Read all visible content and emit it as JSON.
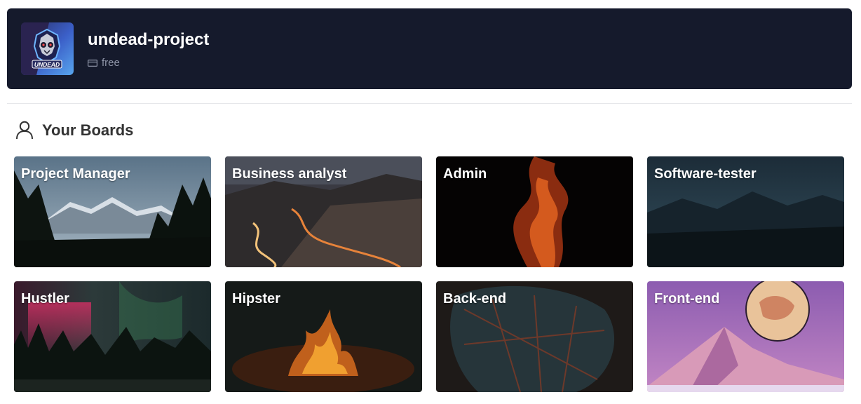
{
  "workspace": {
    "name": "undead-project",
    "plan": "free",
    "logo_text": "UNDEAD"
  },
  "section": {
    "title": "Your Boards"
  },
  "boards": [
    {
      "title": "Project Manager",
      "theme": "pine-forest-mountains"
    },
    {
      "title": "Business analyst",
      "theme": "winding-road-night"
    },
    {
      "title": "Admin",
      "theme": "flame-on-black"
    },
    {
      "title": "Software-tester",
      "theme": "dark-blue-mountains"
    },
    {
      "title": "Hustler",
      "theme": "aurora-forest"
    },
    {
      "title": "Hipster",
      "theme": "campfire"
    },
    {
      "title": "Back-end",
      "theme": "dark-leaf"
    },
    {
      "title": "Front-end",
      "theme": "pink-mountain-moon"
    }
  ],
  "colors": {
    "header_bg": "#151a2c",
    "header_text": "#ffffff",
    "muted_text": "#8f95a8",
    "section_text": "#333333"
  }
}
